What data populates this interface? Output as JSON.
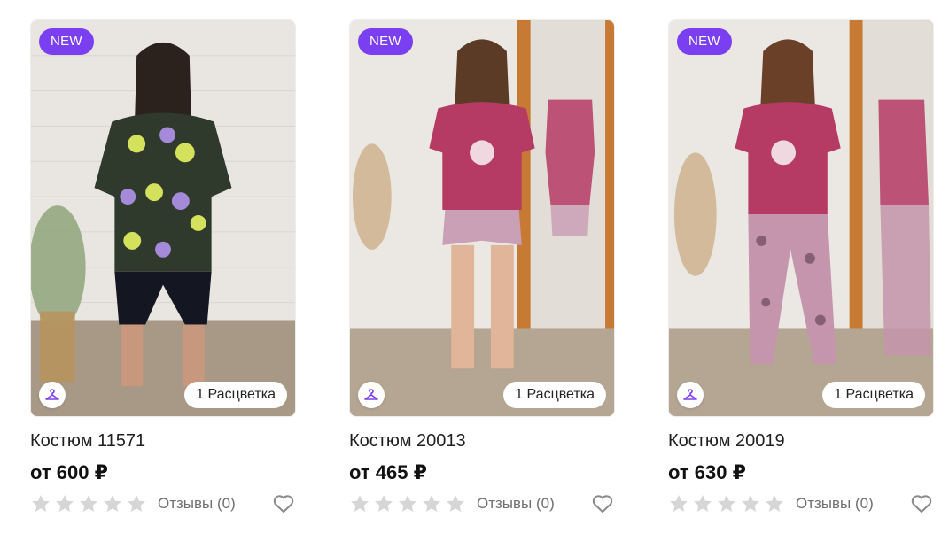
{
  "products": [
    {
      "badge": "NEW",
      "colors_label": "1 Расцветка",
      "title": "Костюм 11571",
      "price": "от 600 ₽",
      "rating": 0,
      "reviews_label": "Отзывы (0)"
    },
    {
      "badge": "NEW",
      "colors_label": "1 Расцветка",
      "title": "Костюм 20013",
      "price": "от 465 ₽",
      "rating": 0,
      "reviews_label": "Отзывы (0)"
    },
    {
      "badge": "NEW",
      "colors_label": "1 Расцветка",
      "title": "Костюм 20019",
      "price": "от 630 ₽",
      "rating": 0,
      "reviews_label": "Отзывы (0)"
    }
  ],
  "colors": {
    "accent": "#7b3ff2",
    "star_empty": "#d6d6d6",
    "text": "#1f1f1f",
    "muted": "#707070"
  }
}
